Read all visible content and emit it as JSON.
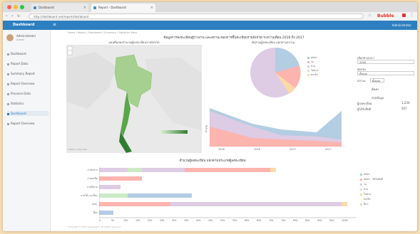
{
  "browser": {
    "tabs": [
      {
        "label": "Dashboard",
        "active": false
      },
      {
        "label": "Report - Dashboard",
        "active": true
      }
    ],
    "url": "http://dashboard.net/report/dashboard",
    "brand": "Bubble"
  },
  "app": {
    "brand": "Dashboard",
    "menu_icon": "menu-icon",
    "user": "Administrator"
  },
  "sidebar": {
    "profile_name": "Administrator",
    "profile_sub": "Admin",
    "items": [
      {
        "label": "Dashboard"
      },
      {
        "label": "Report Data"
      },
      {
        "label": "Summary Report"
      },
      {
        "label": "Report Overview"
      },
      {
        "label": "Province Data"
      },
      {
        "label": "Statistics"
      },
      {
        "label": "Dashboard",
        "active": true
      },
      {
        "label": "Report Overview"
      }
    ]
  },
  "breadcrumb": "Home / Report / Dashboard / Summary / Statistics Data",
  "title": "ข้อมูลการลงทะเบียนผู้ว่างงาน และสถานะของการขึ้นทะเบียนรายจังหวัด ระหว่างเดือน 2016 ถึง 2017",
  "map": {
    "title": "แผนที่แสดงจำนวนผู้ลงทะเบียนรายจังหวัด",
    "footer": "Leaflet | Map data"
  },
  "pie": {
    "title": "สัดส่วนผู้ลงทะเบียน แยกตามสถานะ",
    "legend": [
      "สมัคร",
      "รอ",
      "ผ่าน",
      "ไม่ผ่าน",
      "ยกเลิก"
    ],
    "colors": [
      "#b3cde3",
      "#fbb4ae",
      "#decbe4",
      "#ccebc5",
      "#fed9a6"
    ]
  },
  "area": {
    "ylabel": "จำนวน",
    "x_ticks": [
      "2016",
      "2016",
      "2017",
      "2017"
    ]
  },
  "right_panel": {
    "label1": "เลือกช่วงเวลา",
    "value1": "2016",
    "label2": "จังหวัด",
    "value2": "ทั้งหมด",
    "label3": "สถานะ",
    "value3": "ทั้งหมด",
    "button": "ค้นหา",
    "summary_title": "สรุปข้อมูล",
    "rows": [
      {
        "k": "ผู้ลงทะเบียน",
        "v": "1,234"
      },
      {
        "k": "ผู้ได้รับสิทธิ",
        "v": "567"
      }
    ]
  },
  "bar_chart": {
    "title": "จำนวนผู้ลงทะเบียน แยกตามประเภทผู้ลงทะเบียน",
    "categories": [
      "ภาคกลาง",
      "ภาคเหนือ",
      "ภาคอีสาน",
      "ภาคใต้ และอื่นๆ",
      "กทม.",
      "อื่นๆ"
    ],
    "x_ticks": [
      "0",
      "5k",
      "10k",
      "15k",
      "20k",
      "25k",
      "30k",
      "35k",
      "40k",
      "45k",
      "50k",
      "55k",
      "60k",
      "65k",
      "70k",
      "75k",
      "80k",
      "85k",
      "90k",
      "95k",
      "100k"
    ],
    "legend": [
      "สมัคร",
      "สมัคร - ได้รับสิทธิ",
      "รอ",
      "ผ่าน",
      "ไม่ผ่าน",
      "ยกเลิก",
      "อื่นๆ"
    ]
  },
  "footer": "Copyright © 2017 Dashboard. All rights reserved."
}
